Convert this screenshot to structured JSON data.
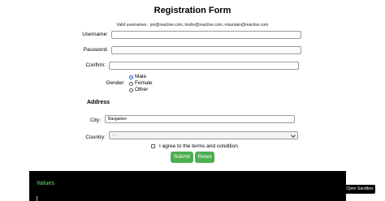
{
  "page": {
    "title": "Registration Form",
    "hint": "Valid usernames : jon@reactive.com, hodor@reactive.com, mountain@reactive.com"
  },
  "form": {
    "username_label": "Username:",
    "username_value": "",
    "password_label": "Password:",
    "password_value": "",
    "confirm_label": "Confirm:",
    "confirm_value": "",
    "gender_label": "Gender:",
    "gender_options": [
      "Male",
      "Female",
      "Other"
    ],
    "gender_selected": "Male",
    "address_heading": "Address",
    "city_label": "City:",
    "city_value": "Bangalore",
    "country_label": "Country:",
    "country_value": "-  -",
    "agree_label": "I agree to the terms and condition.",
    "agree_checked": false,
    "submit_label": "Submit",
    "reset_label": "Reset"
  },
  "values_panel": {
    "title": "Values"
  },
  "sandbox": {
    "label": "Open Sandbox"
  },
  "colors": {
    "button_green": "#4caf50",
    "panel_background": "#000000",
    "panel_title": "#4caf50",
    "radio_accent": "#1a5fd6"
  }
}
